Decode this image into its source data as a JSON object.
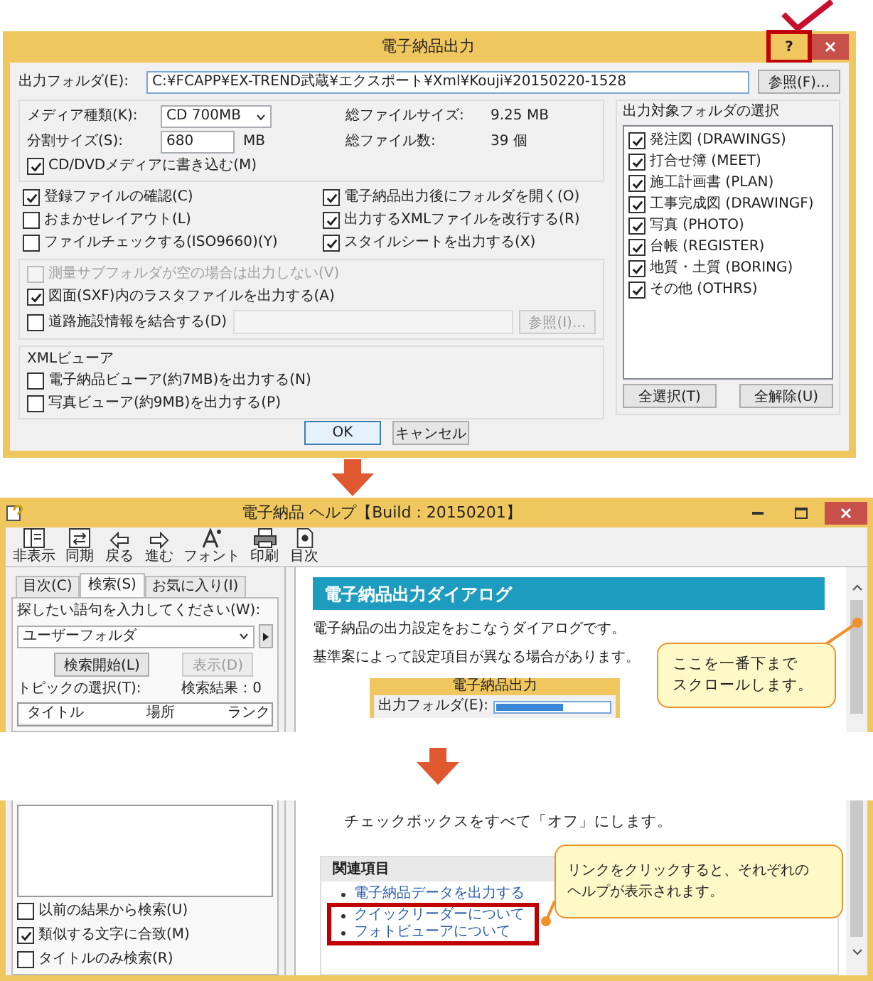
{
  "dialog": {
    "title": "電子納品出力",
    "help_button": "?",
    "output_folder": {
      "label": "出力フォルダ(E):",
      "value": "C:¥FCAPP¥EX-TREND武蔵¥エクスポート¥Xml¥Kouji¥20150220-1528"
    },
    "browse_button": "参照(F)...",
    "media": {
      "label": "メディア種類(K):",
      "value": "CD  700MB"
    },
    "split": {
      "label": "分割サイズ(S):",
      "value": "680",
      "unit": "MB"
    },
    "total_size": {
      "label": "総ファイルサイズ:",
      "value": "9.25 MB"
    },
    "total_count": {
      "label": "総ファイル数:",
      "value": "39 個"
    },
    "write_media": {
      "label": "CD/DVDメディアに書き込む(M)",
      "checked": true
    },
    "options": [
      {
        "label": "登録ファイルの確認(C)",
        "checked": true
      },
      {
        "label": "電子納品出力後にフォルダを開く(O)",
        "checked": true
      },
      {
        "label": "おまかせレイアウト(L)",
        "checked": false
      },
      {
        "label": "出力するXMLファイルを改行する(R)",
        "checked": true
      },
      {
        "label": "ファイルチェックする(ISO9660)(Y)",
        "checked": false
      },
      {
        "label": "スタイルシートを出力する(X)",
        "checked": true
      }
    ],
    "survey_options": [
      {
        "label": "測量サブフォルダが空の場合は出力しない(V)",
        "checked": false,
        "disabled": true
      },
      {
        "label": "図面(SXF)内のラスタファイルを出力する(A)",
        "checked": true,
        "disabled": false
      },
      {
        "label": "道路施設情報を結合する(D)",
        "checked": false,
        "disabled": false
      }
    ],
    "road_browse_button": {
      "label": "参照(I)...",
      "disabled": true
    },
    "xml_viewer": {
      "title": "XMLビューア",
      "options": [
        {
          "label": "電子納品ビューア(約7MB)を出力する(N)",
          "checked": false
        },
        {
          "label": "写真ビューア(約9MB)を出力する(P)",
          "checked": false
        }
      ]
    },
    "folders": {
      "title": "出力対象フォルダの選択",
      "items": [
        {
          "label": "発注図 (DRAWINGS)",
          "checked": true
        },
        {
          "label": "打合せ簿 (MEET)",
          "checked": true
        },
        {
          "label": "施工計画書 (PLAN)",
          "checked": true
        },
        {
          "label": "工事完成図 (DRAWINGF)",
          "checked": true
        },
        {
          "label": "写真 (PHOTO)",
          "checked": true
        },
        {
          "label": "台帳 (REGISTER)",
          "checked": true
        },
        {
          "label": "地質・土質 (BORING)",
          "checked": true
        },
        {
          "label": "その他 (OTHRS)",
          "checked": true
        }
      ],
      "select_all": "全選択(T)",
      "clear_all": "全解除(U)"
    },
    "buttons": [
      "OK",
      "キャンセル"
    ]
  },
  "help_window": {
    "title": "電子納品 ヘルプ【Build : 20150201】",
    "toolbar": [
      {
        "label": "非表示",
        "kind": "hide"
      },
      {
        "label": "同期",
        "kind": "sync"
      },
      {
        "label": "戻る",
        "kind": "back"
      },
      {
        "label": "進む",
        "kind": "forward"
      },
      {
        "label": "フォント",
        "kind": "font"
      },
      {
        "label": "印刷",
        "kind": "print"
      },
      {
        "label": "目次",
        "kind": "contents"
      }
    ],
    "tabs": [
      {
        "label": "目次(C)",
        "selected": false
      },
      {
        "label": "検索(S)",
        "selected": true
      },
      {
        "label": "お気に入り(I)",
        "selected": false
      }
    ],
    "search_label": "探したい語句を入力してください(W):",
    "search_value": "ユーザーフォルダ",
    "search_button": "検索開始(L)",
    "show_button": {
      "label": "表示(D)",
      "disabled": true
    },
    "topic_label": "トピックの選択(T):",
    "result_count": "検索結果：0",
    "columns": [
      "タイトル",
      "場所",
      "ランク"
    ],
    "search_options": [
      {
        "label": "以前の結果から検索(U)",
        "checked": false
      },
      {
        "label": "類似する文字に合致(M)",
        "checked": true
      },
      {
        "label": "タイトルのみ検索(R)",
        "checked": false
      }
    ],
    "heading": "電子納品出力ダイアログ",
    "paragraphs": [
      "電子納品の出力設定をおこなうダイアログです。",
      "基準案によって設定項目が異なる場合があります。"
    ],
    "preview": {
      "title": "電子納品出力",
      "label": "出力フォルダ(E):"
    },
    "instruction": "チェックボックスをすべて「オフ」にします。",
    "related": {
      "title": "関連項目",
      "links": [
        "電子納品データを出力する",
        "クイックリーダーについて",
        "フォトビューアについて"
      ]
    }
  },
  "callouts": [
    {
      "lines": [
        "ここを一番下まで",
        "スクロールします。"
      ]
    },
    {
      "lines": [
        "リンクをクリックすると、それぞれの",
        "ヘルプが表示されます。"
      ]
    }
  ]
}
